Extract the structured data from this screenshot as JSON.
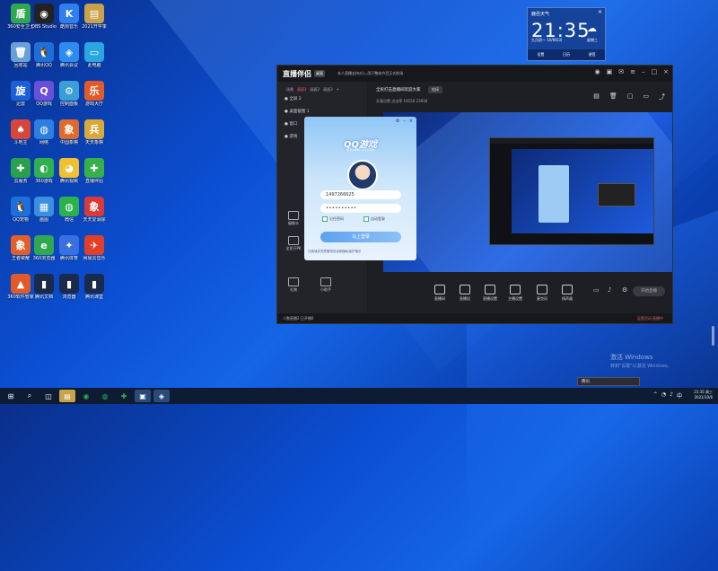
{
  "desktop": {
    "icons": [
      {
        "label": "360安全卫士",
        "glyph": "盾",
        "color": "#2fa84f"
      },
      {
        "label": "OBS Studio",
        "glyph": "◉",
        "color": "#222222"
      },
      {
        "label": "酷狗音乐",
        "glyph": "K",
        "color": "#2f7ff0"
      },
      {
        "label": "2021开学季",
        "glyph": "▤",
        "color": "#c9a24a"
      },
      {
        "label": "回收站",
        "glyph": "🗑",
        "color": "#6aa0d8"
      },
      {
        "label": "腾讯QQ",
        "glyph": "🐧",
        "color": "#1e6fd9"
      },
      {
        "label": "腾讯会议",
        "glyph": "◈",
        "color": "#2d8cf0"
      },
      {
        "label": "此电脑",
        "glyph": "▭",
        "color": "#2aa6e0"
      },
      {
        "label": "迅雷",
        "glyph": "旋",
        "color": "#1c5fd6"
      },
      {
        "label": "QQ游戏",
        "glyph": "Q",
        "color": "#6a4fd8"
      },
      {
        "label": "控制面板",
        "glyph": "⚙",
        "color": "#3a9fd8"
      },
      {
        "label": "游戏大厅",
        "glyph": "乐",
        "color": "#e05a2a"
      },
      {
        "label": "斗地主",
        "glyph": "♠",
        "color": "#d8453a"
      },
      {
        "label": "网络",
        "glyph": "◍",
        "color": "#2c7fe0"
      },
      {
        "label": "中国象棋",
        "glyph": "象",
        "color": "#e06a2a"
      },
      {
        "label": "天天象棋",
        "glyph": "兵",
        "color": "#d8a83a"
      },
      {
        "label": "云服务",
        "glyph": "✚",
        "color": "#2aa04a"
      },
      {
        "label": "360游戏",
        "glyph": "◐",
        "color": "#30b050"
      },
      {
        "label": "腾讯视频",
        "glyph": "◕",
        "color": "#f0c030"
      },
      {
        "label": "直播伴侣",
        "glyph": "✚",
        "color": "#38b04a"
      },
      {
        "label": "QQ宠物",
        "glyph": "🐧",
        "color": "#1e6fd9"
      },
      {
        "label": "画图",
        "glyph": "▦",
        "color": "#3a8fe0"
      },
      {
        "label": "微信",
        "glyph": "◍",
        "color": "#2bb24c"
      },
      {
        "label": "天天爱消除",
        "glyph": "象",
        "color": "#d83a3a"
      },
      {
        "label": "王者荣耀",
        "glyph": "象",
        "color": "#e0602a"
      },
      {
        "label": "360浏览器",
        "glyph": "e",
        "color": "#2fa84f"
      },
      {
        "label": "腾讯体育",
        "glyph": "✦",
        "color": "#3a6fe0"
      },
      {
        "label": "网易云音乐",
        "glyph": "✈",
        "color": "#e0402a"
      },
      {
        "label": "360软件管家",
        "glyph": "▲",
        "color": "#e05a2a"
      },
      {
        "label": "腾讯文档",
        "glyph": "▮",
        "color": "#1a2a4a"
      },
      {
        "label": "浏览器",
        "glyph": "▮",
        "color": "#1a2a4a"
      },
      {
        "label": "腾讯课堂",
        "glyph": "▮",
        "color": "#1a2a4a"
      }
    ]
  },
  "widget": {
    "city": "鹿邑天气",
    "time": "21:35",
    "date": "九月初一 10/06(3)",
    "day": "星期三",
    "tabs": [
      "设置",
      "日历",
      "便签"
    ]
  },
  "app": {
    "title": "直播伴侣",
    "version_badge": "桌面",
    "notice": "本人直播支持对入,用于整体节目正式前场",
    "tabs": [
      "场景",
      "画面1",
      "画面2",
      "画面3"
    ],
    "scenes": [
      "● 全屏 2",
      "● 桌面截图 1",
      "● 窗口",
      "● 游戏"
    ],
    "stream_title": "全民打击直播间欢迎大家",
    "stream_badge": "链接",
    "stream_stats": "开源点赞 点击率 19150 23930",
    "left_tools": [
      "摄像头",
      "全民开PK",
      "礼物",
      "小助手"
    ],
    "bottom_tools": [
      "直播间",
      "直播设",
      "直播设置",
      "主播设置",
      "直播",
      "音乐",
      "摄像头",
      "麦克风",
      "扬声器"
    ],
    "go_live": "开始直播",
    "status_left": "人数直播2 已开播0",
    "status_right": "运营活动 直播中"
  },
  "qq_login": {
    "title": "QQ游戏",
    "subtitle": "QQGAME.QQ.COM",
    "account": "1497266625",
    "password": "••••••••••",
    "remember": "记住密码",
    "auto": "自动登录",
    "login_button": "马上登录",
    "agreement": "已阅读并同意服务协议和隐私保护指引"
  },
  "overlay": {
    "activate_title": "激活 Windows",
    "activate_sub": "转到\"设置\"以激活 Windows。",
    "tooltip": "腾讯"
  },
  "taskbar": {
    "time": "21:35 周三",
    "date": "2021/10/6"
  }
}
